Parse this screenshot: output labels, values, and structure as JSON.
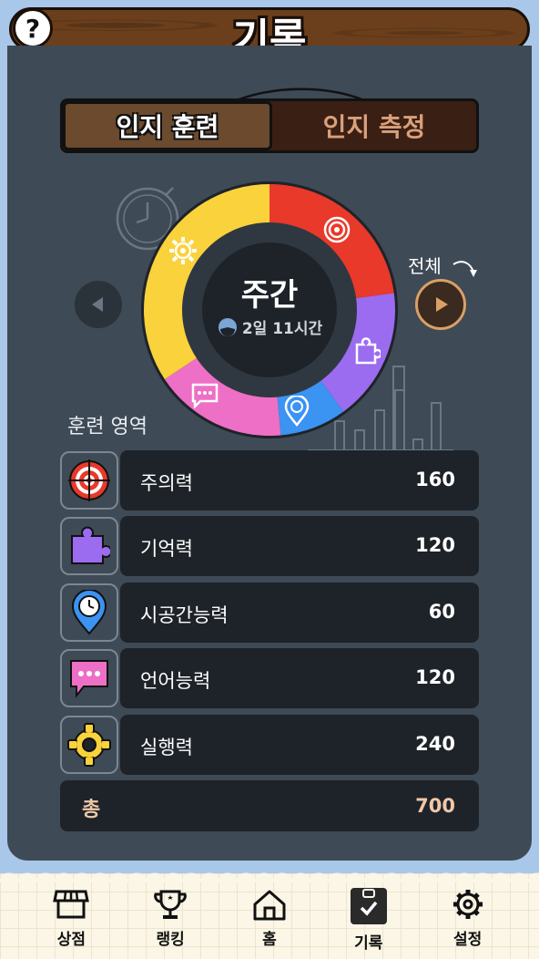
{
  "header": {
    "title": "기록",
    "help_label": "?"
  },
  "tabs": [
    {
      "label": "인지 훈련",
      "active": true
    },
    {
      "label": "인지 측정",
      "active": false
    }
  ],
  "chart": {
    "period_label": "주간",
    "duration_label": "2일 11시간",
    "all_label": "전체"
  },
  "section": {
    "label": "훈련 영역"
  },
  "chart_data": {
    "type": "pie",
    "categories": [
      "주의력",
      "기억력",
      "시공간능력",
      "언어능력",
      "실행력"
    ],
    "values": [
      160,
      120,
      60,
      120,
      240
    ],
    "colors": [
      "#e8392a",
      "#9b6cf0",
      "#3b93f2",
      "#ee6fc6",
      "#f9d23c"
    ]
  },
  "areas": [
    {
      "name": "주의력",
      "value": "160",
      "icon": "target-icon",
      "color": "#e8392a"
    },
    {
      "name": "기억력",
      "value": "120",
      "icon": "puzzle-icon",
      "color": "#9b6cf0"
    },
    {
      "name": "시공간능력",
      "value": "60",
      "icon": "location-clock-icon",
      "color": "#3b93f2"
    },
    {
      "name": "언어능력",
      "value": "120",
      "icon": "speech-bubble-icon",
      "color": "#ee6fc6"
    },
    {
      "name": "실행력",
      "value": "240",
      "icon": "gear-icon",
      "color": "#f9d23c"
    }
  ],
  "total": {
    "label": "총",
    "value": "700"
  },
  "nav": [
    {
      "label": "상점",
      "icon": "shop-icon",
      "active": false
    },
    {
      "label": "랭킹",
      "icon": "trophy-icon",
      "active": false
    },
    {
      "label": "홈",
      "icon": "home-icon",
      "active": false
    },
    {
      "label": "기록",
      "icon": "clipboard-check-icon",
      "active": true
    },
    {
      "label": "설정",
      "icon": "settings-icon",
      "active": false
    }
  ]
}
